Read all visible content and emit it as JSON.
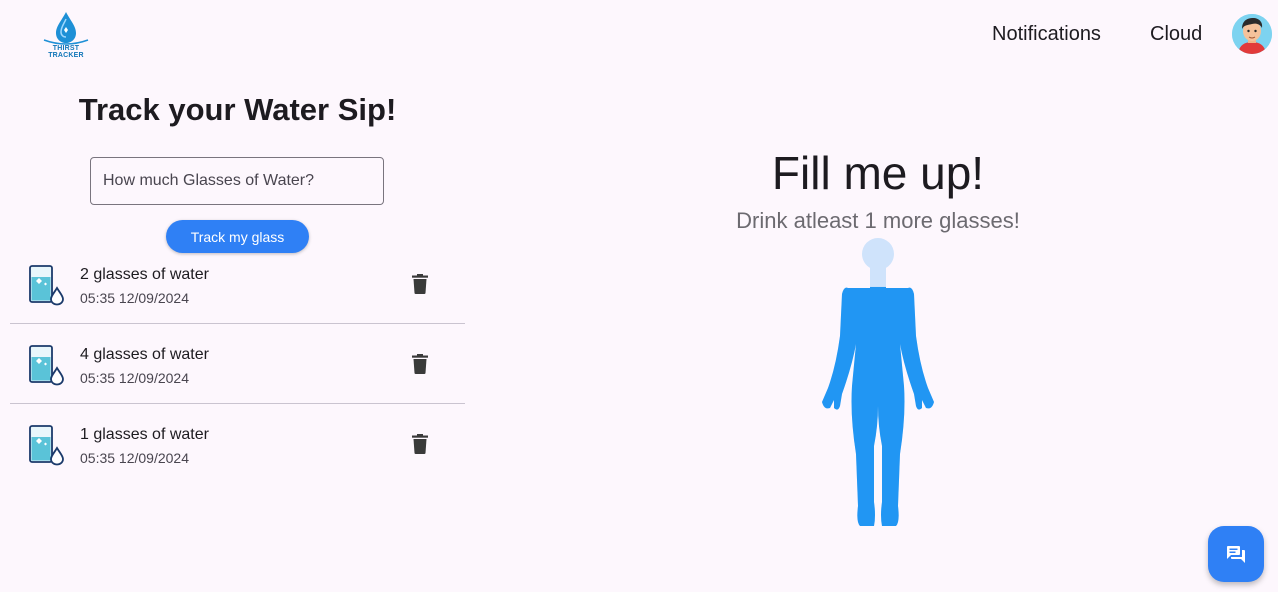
{
  "header": {
    "logo_text": "THIRST TRACKER",
    "nav": {
      "notifications": "Notifications",
      "cloud": "Cloud"
    }
  },
  "tracker": {
    "title": "Track your Water Sip!",
    "input_placeholder": "How much Glasses of Water?",
    "input_value": "",
    "button_label": "Track my glass"
  },
  "entries": [
    {
      "title": "2 glasses of water",
      "time": "05:35 12/09/2024"
    },
    {
      "title": "4 glasses of water",
      "time": "05:35 12/09/2024"
    },
    {
      "title": "1 glasses of water",
      "time": "05:35 12/09/2024"
    }
  ],
  "fill": {
    "title": "Fill me up!",
    "subtitle": "Drink atleast 1 more glasses!",
    "fill_fraction": 0.83
  },
  "colors": {
    "accent": "#2f80f5",
    "water": "#2196f3",
    "empty_body": "#cfe3fb",
    "background": "#fdf7fd"
  },
  "icons": {
    "entry_icon": "water-glass-icon",
    "delete_icon": "trash-icon",
    "fab_icon": "chat-icon"
  }
}
